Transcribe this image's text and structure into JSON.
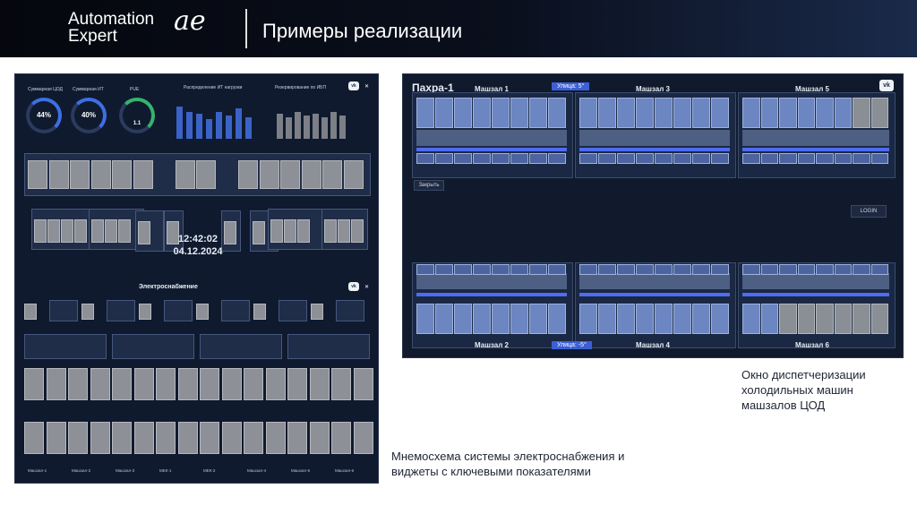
{
  "header": {
    "logo_line1": "Automation",
    "logo_line2": "Expert",
    "logo_mark": "ae",
    "title": "Примеры реализации"
  },
  "right_panel": {
    "site": "Пахра-1",
    "halls": [
      "Машзал 1",
      "Машзал 3",
      "Машзал 5",
      "Машзал 2",
      "Машзал 4",
      "Машзал 6"
    ],
    "street_top": "Улица: 5°",
    "street_bottom": "Улица: -5°",
    "close_button": "Закрыть",
    "login_button": "LOGIN",
    "vk_icon": "vk-icon"
  },
  "left_panel": {
    "kpi_labels": [
      "Суммарная ЦОД",
      "Суммарная ИТ",
      "PUE"
    ],
    "kpi_values": [
      "44%",
      "40%",
      "1.1"
    ],
    "chart1_title": "Распределение ИТ нагрузки",
    "chart2_title": "Резервирование по ИБП",
    "clock_time": "12:42:02",
    "clock_date": "04.12.2024",
    "section_title": "Электроснабжение",
    "bottom_labels": [
      "Машзал-1",
      "Машзал-2",
      "Машзал-3",
      "МЕК-1",
      "МЕК-2",
      "Машзал-4",
      "Машзал-5",
      "Машзал-6"
    ]
  },
  "captions": {
    "right": "Окно диспетчеризации холодильных машин машзалов ЦОД",
    "left": "Мнемосхема системы электроснабжения и виджеты с ключевыми показателями"
  }
}
